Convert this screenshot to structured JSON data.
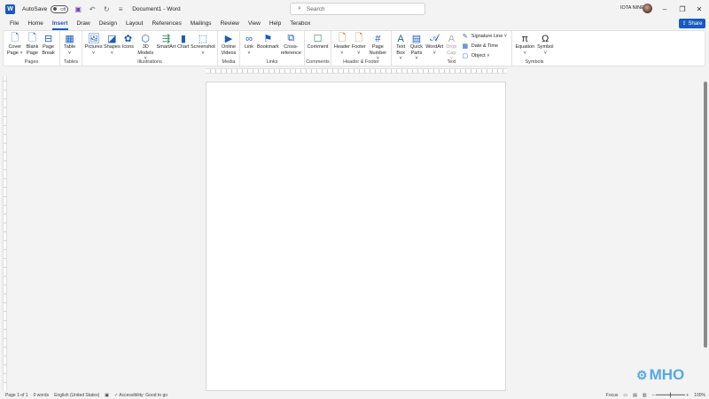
{
  "titlebar": {
    "app_logo": "W",
    "autosave_label": "AutoSave",
    "autosave_state": "Off",
    "doc_title": "Document1 - Word",
    "search_placeholder": "Search",
    "user_name": "IOTA NINE",
    "undo_icon": "undo-icon",
    "redo_icon": "redo-icon"
  },
  "tabs": [
    "File",
    "Home",
    "Insert",
    "Draw",
    "Design",
    "Layout",
    "References",
    "Mailings",
    "Review",
    "View",
    "Help",
    "Terabox"
  ],
  "active_tab": "Insert",
  "share_label": "Share",
  "ribbon": {
    "pages": {
      "label": "Pages",
      "buttons": [
        "Cover\nPage ˅",
        "Blank\nPage",
        "Page\nBreak"
      ]
    },
    "tables": {
      "label": "Tables",
      "buttons": [
        "Table\n˅"
      ]
    },
    "illustrations": {
      "label": "Illustrations",
      "buttons": [
        "Pictures\n˅",
        "Shapes\n˅",
        "Icons",
        "3D\nModels ˅",
        "SmartArt",
        "Chart",
        "Screenshot\n˅"
      ]
    },
    "media": {
      "label": "Media",
      "buttons": [
        "Online\nVideos"
      ]
    },
    "links": {
      "label": "Links",
      "buttons": [
        "Link\n˅",
        "Bookmark",
        "Cross-\nreference"
      ]
    },
    "comments": {
      "label": "Comments",
      "buttons": [
        "Comment"
      ]
    },
    "header_footer": {
      "label": "Header & Footer",
      "buttons": [
        "Header\n˅",
        "Footer\n˅",
        "Page\nNumber ˅"
      ]
    },
    "text": {
      "label": "Text",
      "buttons": [
        "Text\nBox ˅",
        "Quick\nParts ˅",
        "WordArt\n˅",
        "Drop\nCap ˅"
      ],
      "small": [
        "Signature Line ˅",
        "Date & Time",
        "Object ˅"
      ]
    },
    "symbols": {
      "label": "Symbols",
      "buttons": [
        "Equation\n˅",
        "Symbol\n˅"
      ]
    }
  },
  "status": {
    "page": "Page 1 of 1",
    "words": "0 words",
    "language": "English (United States)",
    "accessibility": "Accessibility: Good to go",
    "focus": "Focus",
    "zoom": "100%"
  },
  "watermark_text": "MHO",
  "colors": {
    "accent": "#185abd",
    "watermark": "#55a9e6"
  }
}
